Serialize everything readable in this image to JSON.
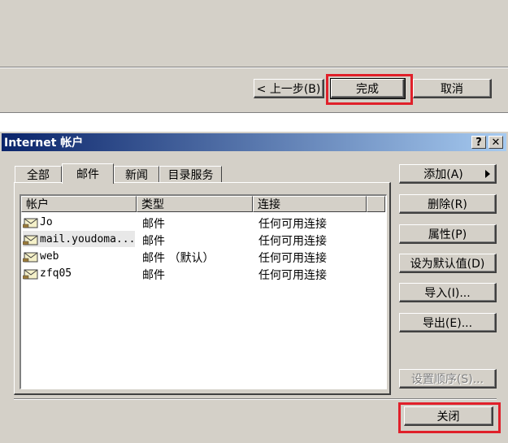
{
  "wizard": {
    "back_label": "< 上一步(B)",
    "finish_label": "完成",
    "cancel_label": "取消"
  },
  "dialog": {
    "title": "Internet 帐户",
    "help_btn": "?",
    "close_btn": "✕",
    "tabs": [
      {
        "label": "全部",
        "active": false
      },
      {
        "label": "邮件",
        "active": true
      },
      {
        "label": "新闻",
        "active": false
      },
      {
        "label": "目录服务",
        "active": false
      }
    ],
    "columns": [
      "帐户",
      "类型",
      "连接"
    ],
    "rows": [
      {
        "name": "Jo",
        "type": "邮件",
        "connection": "任何可用连接",
        "icon": "mail-account-icon"
      },
      {
        "name": "mail.youdoma...",
        "type": "邮件",
        "connection": "任何可用连接",
        "icon": "mail-account-icon",
        "selected": true
      },
      {
        "name": "web",
        "type": "邮件 （默认）",
        "connection": "任何可用连接",
        "icon": "mail-account-icon"
      },
      {
        "name": "zfq05",
        "type": "邮件",
        "connection": "任何可用连接",
        "icon": "mail-account-icon"
      }
    ],
    "buttons": {
      "add": "添加(A)",
      "remove": "删除(R)",
      "properties": "属性(P)",
      "set_default": "设为默认值(D)",
      "import": "导入(I)...",
      "export": "导出(E)...",
      "set_order": "设置顺序(S)...",
      "close": "关闭"
    }
  },
  "colors": {
    "highlight_box": "#e0202a",
    "title_start": "#0a246a",
    "title_end": "#a6caf0",
    "face": "#d4d0c8"
  }
}
